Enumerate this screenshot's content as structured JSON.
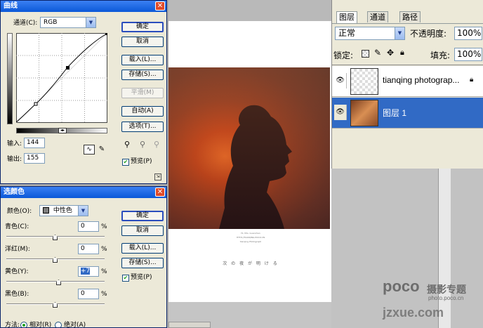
{
  "curves": {
    "title": "曲线",
    "channel_label": "通道(C):",
    "channel_value": "RGB",
    "buttons": [
      "确定",
      "取消",
      "载入(L)...",
      "存储(S)...",
      "平滑(M)",
      "自动(A)",
      "选项(T)..."
    ],
    "preview_label": "预览(P)",
    "preview_checked": true,
    "input_label": "输入:",
    "input_value": "144",
    "output_label": "输出:",
    "output_value": "155"
  },
  "selective_color": {
    "title": "选颜色",
    "colors_label": "颜色(O):",
    "colors_value": "中性色",
    "rows": [
      {
        "label": "青色(C):",
        "value": "0",
        "unit": "%",
        "slider": 0.5
      },
      {
        "label": "洋红(M):",
        "value": "0",
        "unit": "%",
        "slider": 0.5
      },
      {
        "label": "黄色(Y):",
        "value": "+7",
        "unit": "%",
        "slider": 0.535
      },
      {
        "label": "黑色(B):",
        "value": "0",
        "unit": "%",
        "slider": 0.5
      }
    ],
    "buttons": [
      "确定",
      "取消",
      "载入(L)...",
      "存储(S)..."
    ],
    "preview_label": "预览(P)",
    "method_label": "方法:",
    "method_relative": "相对(R)",
    "method_absolute": "绝对(A)"
  },
  "canvas": {
    "caption_line1": "Hi, Mrs. Guanchen",
    "caption_line2": "HTTP://TIANQING.POCO.CN",
    "caption_line3": "tianqing Photograph",
    "japanese_text": "次 の 夜 が 明 け る"
  },
  "layers_panel": {
    "tabs": [
      "图层",
      "通道",
      "路径"
    ],
    "blend_mode": "正常",
    "opacity_label": "不透明度:",
    "opacity_value": "100%",
    "lock_label": "锁定:",
    "fill_label": "填充:",
    "fill_value": "100%",
    "layers": [
      {
        "name": "tianqing photograp...",
        "selected": false
      },
      {
        "name": "图层 1",
        "selected": true
      }
    ]
  },
  "watermark": {
    "line1": "poco",
    "line2": "摄影专题",
    "line3": "photo.poco.cn",
    "line4": "jzxue.com"
  },
  "colors": {
    "selection_blue": "#316ac5",
    "title_blue": "#0a58d8"
  }
}
